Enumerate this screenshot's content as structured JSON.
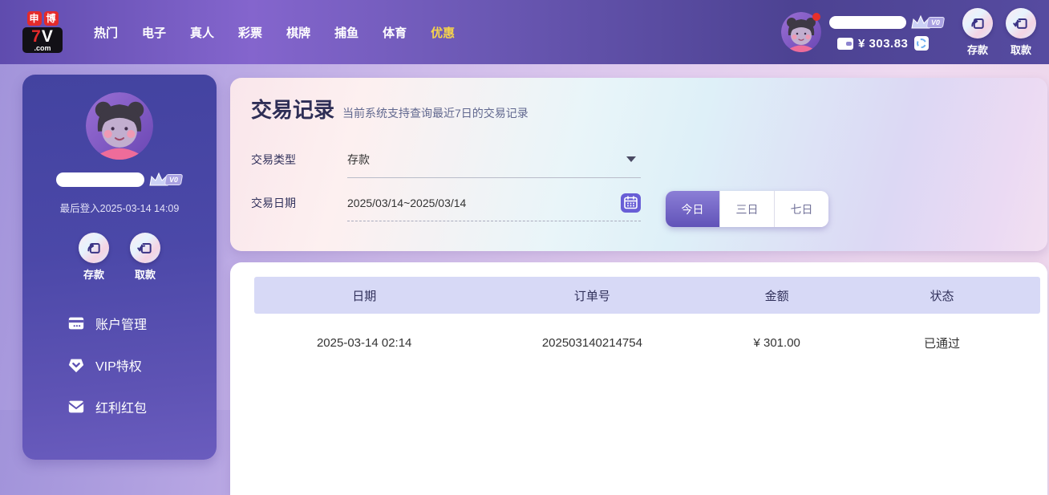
{
  "brand": {
    "badge_left": "申",
    "badge_right": "博",
    "name_red": "7",
    "name_white": "V",
    "tld": ".com"
  },
  "nav": {
    "items": [
      "热门",
      "电子",
      "真人",
      "彩票",
      "棋牌",
      "捕鱼",
      "体育",
      "优惠"
    ],
    "active_item": "优惠"
  },
  "colors": {
    "nav_active": "#f5d34c",
    "accent_purple": "#6153b8",
    "table_header_bg": "#d7d9f6"
  },
  "user": {
    "vip_label": "V0",
    "balance": "¥ 303.83",
    "last_login": "最后登入2025-03-14 14:09"
  },
  "actions": {
    "deposit": "存款",
    "withdraw": "取款"
  },
  "sidebar": {
    "menu": [
      {
        "icon": "account-card",
        "label": "账户管理"
      },
      {
        "icon": "vip-badge",
        "label": "VIP特权"
      },
      {
        "icon": "red-envelope",
        "label": "红利红包"
      }
    ]
  },
  "main": {
    "title": "交易记录",
    "subtitle": "当前系统支持查询最近7日的交易记录",
    "filters": {
      "type_label": "交易类型",
      "type_value": "存款",
      "date_label": "交易日期",
      "date_value": "2025/03/14~2025/03/14",
      "ranges": [
        "今日",
        "三日",
        "七日"
      ],
      "active_range": "今日"
    },
    "table": {
      "headers": [
        "日期",
        "订单号",
        "金额",
        "状态"
      ],
      "rows": [
        {
          "date": "2025-03-14 02:14",
          "order_no": "202503140214754",
          "amount": "¥ 301.00",
          "status": "已通过"
        }
      ]
    }
  }
}
